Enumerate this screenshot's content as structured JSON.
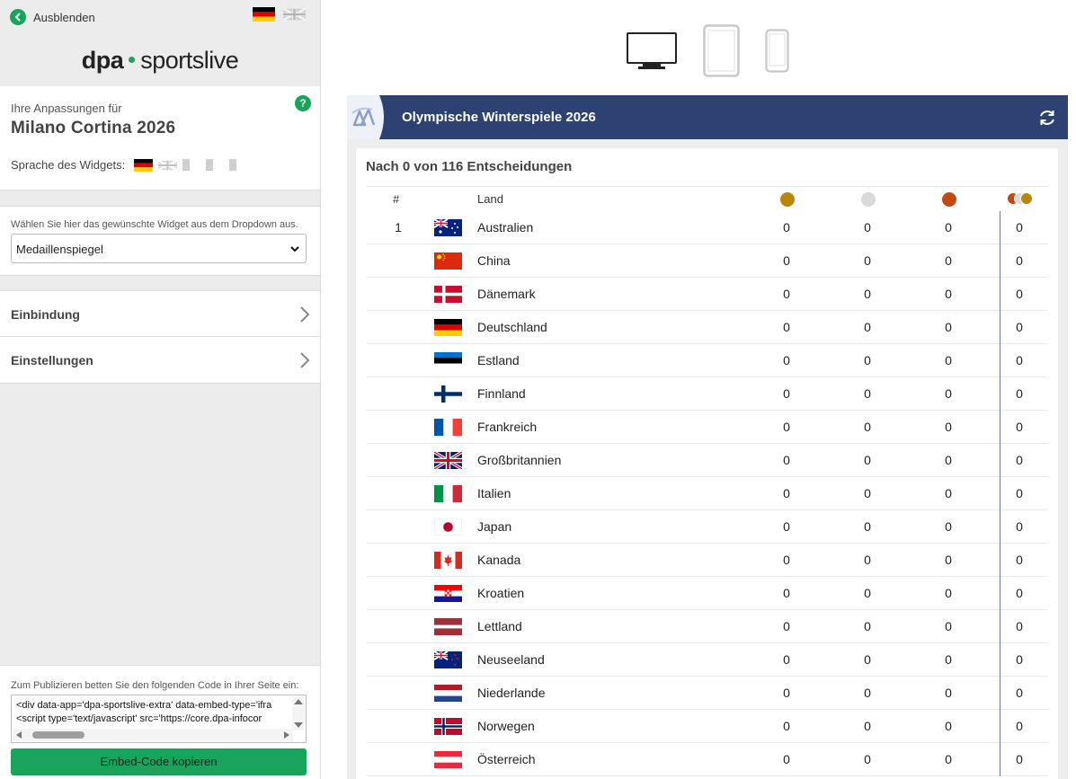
{
  "sidebar": {
    "hide_label": "Ausblenden",
    "logo_dpa": "dpa",
    "logo_sportslive": "sportslive",
    "customization_subtitle": "Ihre Anpassungen für",
    "customization_title": "Milano Cortina 2026",
    "help_symbol": "?",
    "language_label": "Sprache des Widgets:",
    "widget_hint": "Wählen Sie hier das gewünschte Widget aus dem Dropdown aus.",
    "widget_selected": "Medaillenspiegel",
    "sections": [
      "Einbindung",
      "Einstellungen"
    ],
    "embed_hint": "Zum Publizieren betten Sie den folgenden Code in Ihrer Seite ein:",
    "embed_line1": "<div data-app='dpa-sportslive-extra' data-embed-type='ifra",
    "embed_line2": "<script type='text/javascript' src='https://core.dpa-infocor",
    "copy_button": "Embed-Code kopieren"
  },
  "devices": [
    "desktop-icon",
    "tablet-icon",
    "phone-icon"
  ],
  "widget": {
    "title": "Olympische Winterspiele 2026",
    "subtitle": "Nach 0 von 116 Entscheidungen",
    "col_rank": "#",
    "col_country": "Land",
    "medal_colors": {
      "gold": "#b8860b",
      "silver": "#d9d9d9",
      "bronze": "#c04a12"
    },
    "header_color": "#2d4273",
    "rows": [
      {
        "rank": "1",
        "country": "Australien",
        "flag": "au",
        "gold": "0",
        "silver": "0",
        "bronze": "0",
        "total": "0"
      },
      {
        "rank": "",
        "country": "China",
        "flag": "cn",
        "gold": "0",
        "silver": "0",
        "bronze": "0",
        "total": "0"
      },
      {
        "rank": "",
        "country": "Dänemark",
        "flag": "dk",
        "gold": "0",
        "silver": "0",
        "bronze": "0",
        "total": "0"
      },
      {
        "rank": "",
        "country": "Deutschland",
        "flag": "de",
        "gold": "0",
        "silver": "0",
        "bronze": "0",
        "total": "0"
      },
      {
        "rank": "",
        "country": "Estland",
        "flag": "ee",
        "gold": "0",
        "silver": "0",
        "bronze": "0",
        "total": "0"
      },
      {
        "rank": "",
        "country": "Finnland",
        "flag": "fi",
        "gold": "0",
        "silver": "0",
        "bronze": "0",
        "total": "0"
      },
      {
        "rank": "",
        "country": "Frankreich",
        "flag": "fr",
        "gold": "0",
        "silver": "0",
        "bronze": "0",
        "total": "0"
      },
      {
        "rank": "",
        "country": "Großbritannien",
        "flag": "gb",
        "gold": "0",
        "silver": "0",
        "bronze": "0",
        "total": "0"
      },
      {
        "rank": "",
        "country": "Italien",
        "flag": "it",
        "gold": "0",
        "silver": "0",
        "bronze": "0",
        "total": "0"
      },
      {
        "rank": "",
        "country": "Japan",
        "flag": "jp",
        "gold": "0",
        "silver": "0",
        "bronze": "0",
        "total": "0"
      },
      {
        "rank": "",
        "country": "Kanada",
        "flag": "ca",
        "gold": "0",
        "silver": "0",
        "bronze": "0",
        "total": "0"
      },
      {
        "rank": "",
        "country": "Kroatien",
        "flag": "hr",
        "gold": "0",
        "silver": "0",
        "bronze": "0",
        "total": "0"
      },
      {
        "rank": "",
        "country": "Lettland",
        "flag": "lv",
        "gold": "0",
        "silver": "0",
        "bronze": "0",
        "total": "0"
      },
      {
        "rank": "",
        "country": "Neuseeland",
        "flag": "nz",
        "gold": "0",
        "silver": "0",
        "bronze": "0",
        "total": "0"
      },
      {
        "rank": "",
        "country": "Niederlande",
        "flag": "nl",
        "gold": "0",
        "silver": "0",
        "bronze": "0",
        "total": "0"
      },
      {
        "rank": "",
        "country": "Norwegen",
        "flag": "no",
        "gold": "0",
        "silver": "0",
        "bronze": "0",
        "total": "0"
      },
      {
        "rank": "",
        "country": "Österreich",
        "flag": "at",
        "gold": "0",
        "silver": "0",
        "bronze": "0",
        "total": "0"
      }
    ]
  }
}
